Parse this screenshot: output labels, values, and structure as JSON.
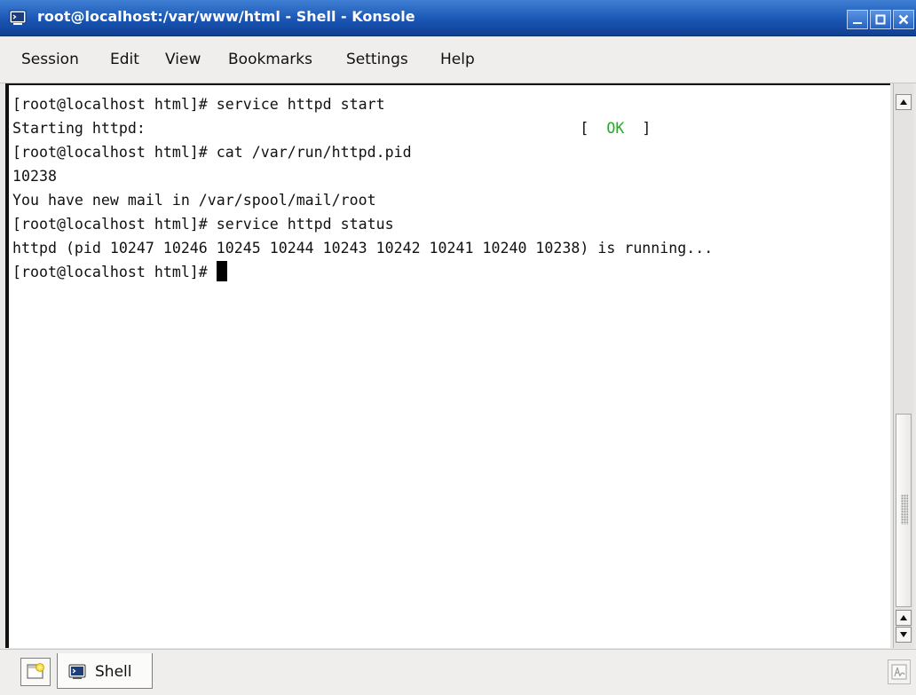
{
  "window": {
    "title": "root@localhost:/var/www/html - Shell - Konsole",
    "title_icon": "terminal-icon",
    "buttons": [
      "minimize",
      "maximize",
      "close"
    ],
    "titlebar_color": "#1a56b4"
  },
  "menu": {
    "items": [
      "Session",
      "Edit",
      "View",
      "Bookmarks",
      "Settings",
      "Help"
    ]
  },
  "terminal": {
    "lines": [
      "[root@localhost html]# service httpd start",
      "Starting httpd:",
      "[root@localhost html]# cat /var/run/httpd.pid",
      "10238",
      "You have new mail in /var/spool/mail/root",
      "[root@localhost html]# service httpd status",
      "httpd (pid 10247 10246 10245 10244 10243 10242 10241 10240 10238) is running...",
      "[root@localhost html]# "
    ],
    "status_open": "[",
    "status_ok": "OK",
    "status_close": "]",
    "ok_color": "#1fae1f"
  },
  "tabs": {
    "items": [
      {
        "label": "Shell",
        "icon": "terminal-icon"
      }
    ],
    "new_tab_icon": "new-session-icon",
    "close_tab_icon": "close-session-icon"
  }
}
